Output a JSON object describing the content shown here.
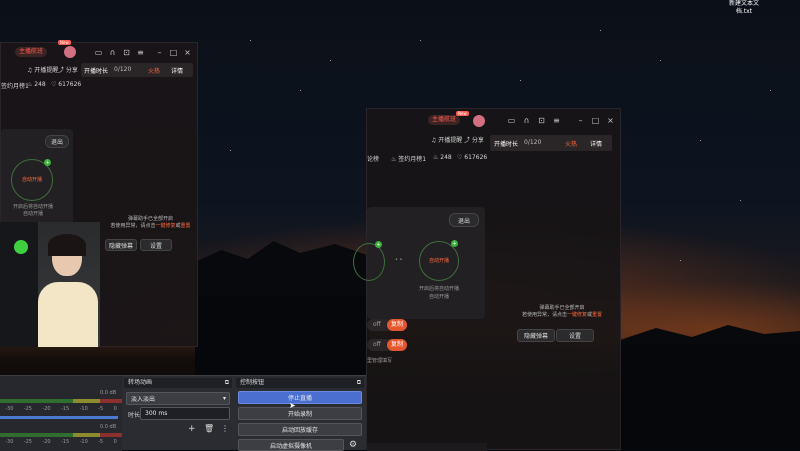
{
  "desktop": {
    "file_label": "新建文本文档.txt"
  },
  "left_app": {
    "host_badge": "主播航班",
    "new_tag": "New",
    "title_icons": [
      "chat-icon",
      "headset-icon",
      "share-icon",
      "menu-icon",
      "minimize-icon",
      "maximize-icon",
      "close-icon"
    ],
    "remind": "开播提醒",
    "share": "分享",
    "rank": "签约月榜1",
    "fire_count": "248",
    "likes": "617626",
    "live_time_label": "开播时长",
    "live_time_value": "0/120",
    "hot_label": "火热",
    "detail_label": "详情",
    "exit_label": "退出",
    "auto_label": "自动开播",
    "circle_caption_1": "开启后将自动开播",
    "circle_caption_2": "自动开播",
    "notice_line1": "弹幕助手已全部开启",
    "notice_line2a": "若使用异常，请点击",
    "notice_link1": "一键修复",
    "notice_or": "或",
    "notice_link2": "重置",
    "hide_btn": "隐藏弹幕",
    "settings_btn": "设置"
  },
  "right_app": {
    "host_badge": "主播航班",
    "new_tag": "New",
    "remind": "开播提醒",
    "share": "分享",
    "rank": "签约月榜1",
    "fire_count": "248",
    "likes": "617626",
    "live_time_label": "开播时长",
    "live_time_value": "0/120",
    "hot_label": "火热",
    "detail_label": "详情",
    "exit_label": "退出",
    "auto_label": "自动开播",
    "circle_caption_1": "开启后将自动开播",
    "circle_caption_2": "自动开播",
    "side_label": "论榜",
    "toggle_on": "复制",
    "toggle_off": "off",
    "manage_label": "里管理填写",
    "notice_line1": "弹幕助手已全部开启",
    "notice_line2a": "若使用异常，请点击",
    "notice_link1": "一键修复",
    "notice_or": "或",
    "notice_link2": "重置",
    "hide_btn": "隐藏弹幕",
    "settings_btn": "设置"
  },
  "obs": {
    "transition_header": "转场动画",
    "transition_value": "淡入淡出",
    "duration_label": "时长",
    "duration_value": "300 ms",
    "controls_header": "控制按钮",
    "stop_stream": "停止直播",
    "start_record": "开始录制",
    "replay_buffer": "启动回放缓存",
    "virtual_cam": "启动虚拟摄像机",
    "meter_db_1": "0.0 dB",
    "meter_db_2": "0.0 dB",
    "meter_ticks": [
      "-30",
      "-25",
      "-20",
      "-15",
      "-10",
      "-5",
      "0"
    ],
    "colors": {
      "stop_stream_bg": "#4a6fd0"
    }
  }
}
